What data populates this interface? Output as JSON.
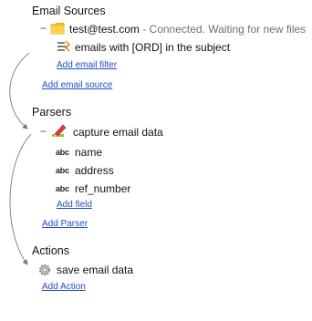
{
  "email_sources": {
    "header": "Email Sources",
    "account": {
      "toggle": "−",
      "icon": "folder-icon",
      "address": "test@test.com",
      "status": " - Connected. Waiting for new files"
    },
    "filters": [
      {
        "icon": "filter-icon",
        "label": "emails with [ORD] in the subject"
      }
    ],
    "add_filter_link": "Add email filter",
    "add_source_link": "Add email source"
  },
  "parsers": {
    "header": "Parsers",
    "parser": {
      "toggle": "−",
      "icon": "parser-pen-icon",
      "label": "capture email data"
    },
    "fields": [
      {
        "icon_text": "abc",
        "label": "name"
      },
      {
        "icon_text": "abc",
        "label": "address"
      },
      {
        "icon_text": "abc",
        "label": "ref_number"
      }
    ],
    "add_field_link": "Add field",
    "add_parser_link": "Add Parser"
  },
  "actions": {
    "header": "Actions",
    "items": [
      {
        "icon": "gear-icon",
        "label": "save email data"
      }
    ],
    "add_action_link": "Add Action"
  }
}
